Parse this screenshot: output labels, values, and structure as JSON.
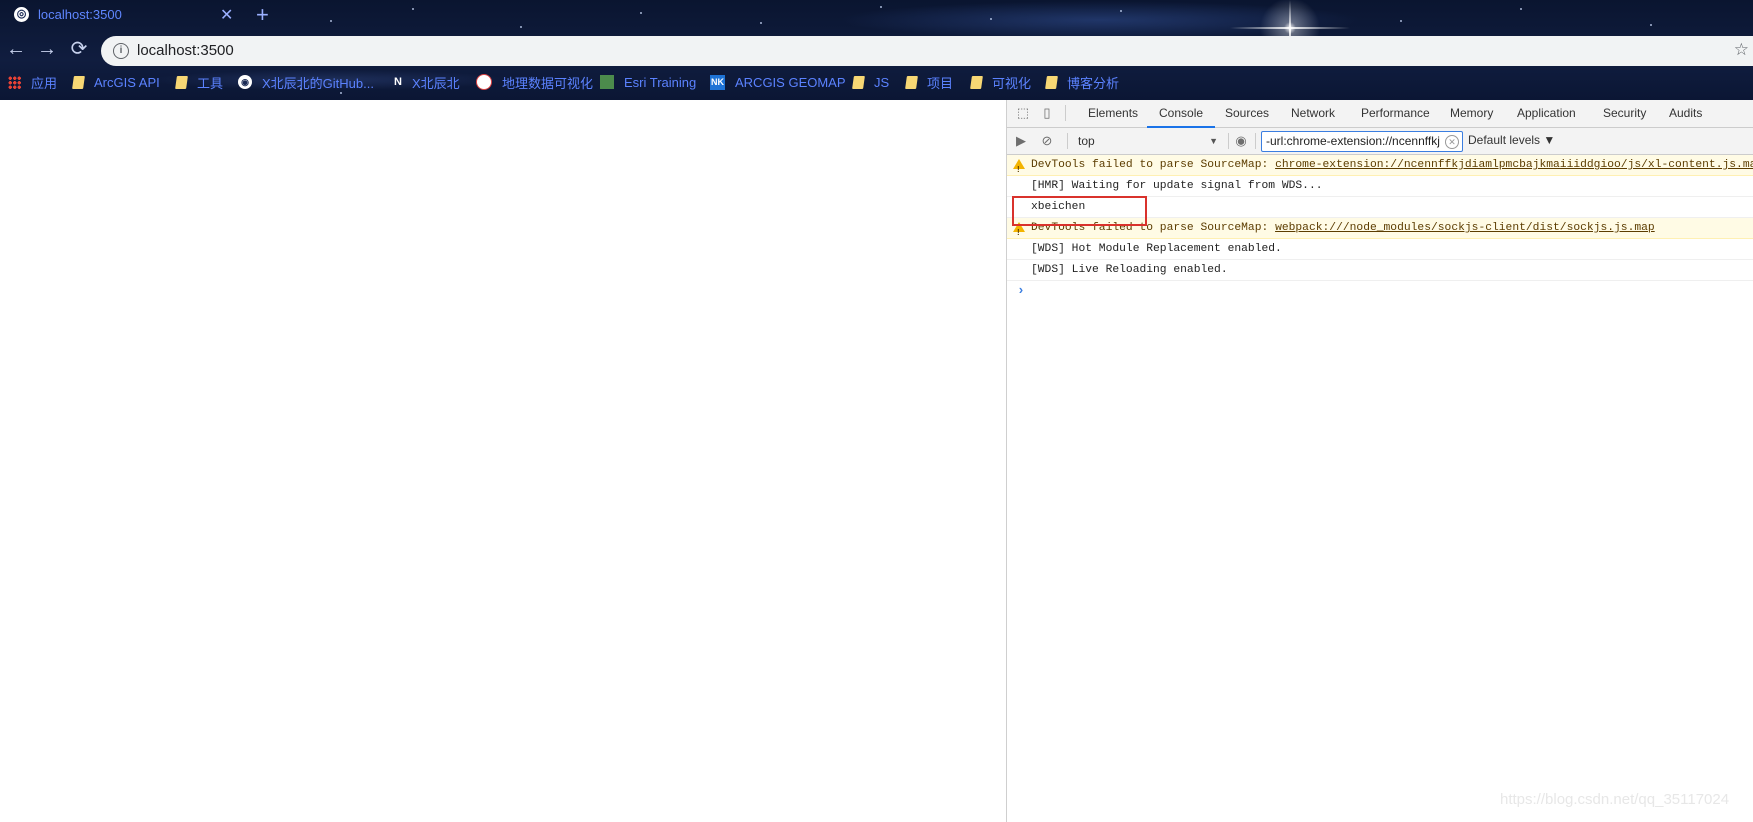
{
  "browser": {
    "tab_title": "localhost:3500",
    "new_tab_icon": "plus-icon",
    "url": "localhost:3500",
    "bookmarks": [
      {
        "label": "应用",
        "icon": "apps-icon"
      },
      {
        "label": "ArcGIS API",
        "icon": "folder-icon"
      },
      {
        "label": "工具",
        "icon": "folder-icon"
      },
      {
        "label": "X北辰北的GitHub...",
        "icon": "github-icon"
      },
      {
        "label": "X北辰北",
        "icon": "notion-icon"
      },
      {
        "label": "地理数据可视化",
        "icon": "site-icon"
      },
      {
        "label": "Esri Training",
        "icon": "esri-icon"
      },
      {
        "label": "ARCGIS GEOMAP",
        "icon": "nk-icon"
      },
      {
        "label": "JS",
        "icon": "folder-icon"
      },
      {
        "label": "项目",
        "icon": "folder-icon"
      },
      {
        "label": "可视化",
        "icon": "folder-icon"
      },
      {
        "label": "博客分析",
        "icon": "folder-icon"
      }
    ]
  },
  "devtools": {
    "tabs": [
      "Elements",
      "Console",
      "Sources",
      "Network",
      "Performance",
      "Memory",
      "Application",
      "Security",
      "Audits"
    ],
    "active_tab": "Console",
    "context": "top",
    "filter_value": "-url:chrome-extension://ncennffkj",
    "levels": "Default levels ▼",
    "messages": [
      {
        "type": "warning",
        "prefix": "DevTools failed to parse SourceMap: ",
        "link": "chrome-extension://ncennffkjdiamlpmcbajkmaiiiddgioo/js/xl-content.js.map"
      },
      {
        "type": "log",
        "text": "[HMR] Waiting for update signal from WDS..."
      },
      {
        "type": "log",
        "text": "xbeichen"
      },
      {
        "type": "warning",
        "prefix": "DevTools failed to parse SourceMap: ",
        "link": "webpack:///node_modules/sockjs-client/dist/sockjs.js.map"
      },
      {
        "type": "log",
        "text": "[WDS] Hot Module Replacement enabled."
      },
      {
        "type": "log",
        "text": "[WDS] Live Reloading enabled."
      }
    ],
    "prompt_symbol": "›"
  },
  "watermark": "https://blog.csdn.net/qq_35117024",
  "colors": {
    "highlight_box": "#d9322c",
    "active_tab_underline": "#1a73e8",
    "warning_bg": "#fffbe5"
  }
}
